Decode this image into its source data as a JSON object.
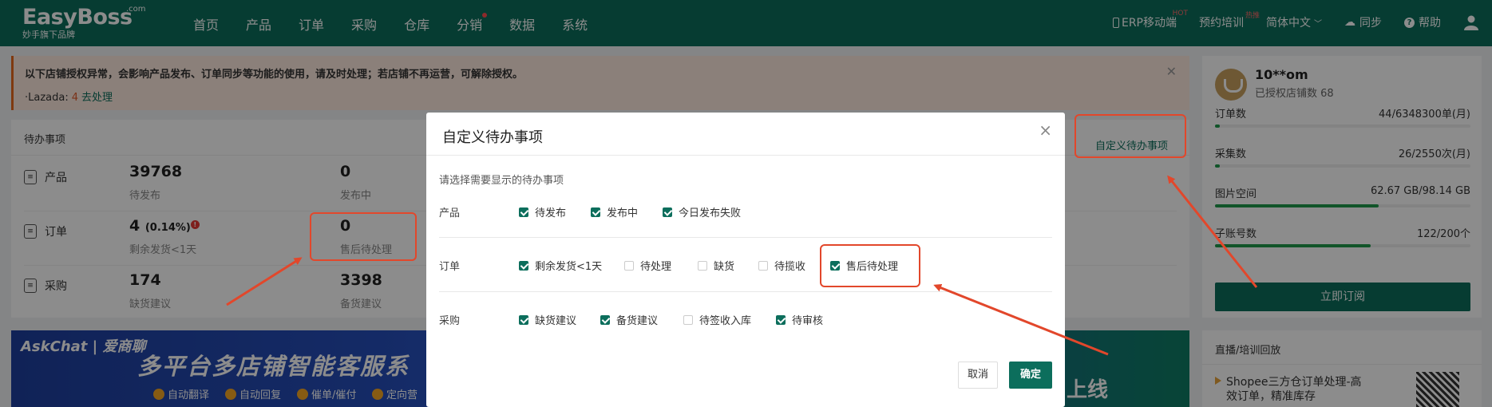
{
  "brand": {
    "name": "EasyBoss",
    "com": ".com",
    "tagline": "妙手旗下品牌"
  },
  "nav": [
    "首页",
    "产品",
    "订单",
    "采购",
    "仓库",
    "分销",
    "数据",
    "系统"
  ],
  "right_nav": {
    "erp": "ERP移动端",
    "erp_badge": "HOT",
    "training": "预约培训",
    "training_badge": "热推",
    "language": "简体中文",
    "sync": "同步",
    "help": "帮助"
  },
  "alert": {
    "message": "以下店铺授权异常，会影响产品发布、订单同步等功能的使用，请及时处理；若店铺不再运营，可解除授权。",
    "platform": "·Lazada:",
    "count": "4",
    "action": "去处理"
  },
  "todo": {
    "title": "待办事项",
    "custom_link": "自定义待办事项",
    "rows": [
      {
        "label": "产品",
        "items": [
          {
            "value": "39768",
            "label": "待发布"
          },
          {
            "value": "0",
            "label": "发布中"
          }
        ]
      },
      {
        "label": "订单",
        "items": [
          {
            "value": "4",
            "pct": "(0.14%)",
            "label": "剩余发货<1天"
          },
          {
            "value": "0",
            "label": "售后待处理"
          }
        ]
      },
      {
        "label": "采购",
        "items": [
          {
            "value": "174",
            "label": "缺货建议"
          },
          {
            "value": "3398",
            "label": "备货建议"
          }
        ]
      }
    ]
  },
  "banner": {
    "logo": "AskChat | 爱商聊",
    "headline": "多平台多店铺智能客服系",
    "features": [
      "自动翻译",
      "自动回复",
      "催单/催付",
      "定向营"
    ],
    "online": "上线"
  },
  "account": {
    "name": "10**om",
    "shops": "已授权店铺数 68",
    "stats": [
      {
        "key": "订单数",
        "value": "44/6348300单(月)",
        "ratio": 0.01
      },
      {
        "key": "采集数",
        "value": "26/2550次(月)",
        "ratio": 0.01
      },
      {
        "key": "图片空间",
        "value": "62.67 GB/98.14 GB",
        "ratio": 0.64
      },
      {
        "key": "子账号数",
        "value": "122/200个",
        "ratio": 0.61
      }
    ],
    "subscribe": "立即订阅"
  },
  "live": {
    "title": "直播/培训回放",
    "line1": "Shopee三方仓订单处理-高",
    "line2": "效订单，精准库存"
  },
  "modal": {
    "title": "自定义待办事项",
    "hint": "请选择需要显示的待办事项",
    "groups": [
      {
        "label": "产品",
        "options": [
          {
            "text": "待发布",
            "checked": true
          },
          {
            "text": "发布中",
            "checked": true
          },
          {
            "text": "今日发布失败",
            "checked": true
          }
        ]
      },
      {
        "label": "订单",
        "options": [
          {
            "text": "剩余发货<1天",
            "checked": true
          },
          {
            "text": "待处理",
            "checked": false
          },
          {
            "text": "缺货",
            "checked": false
          },
          {
            "text": "待揽收",
            "checked": false
          },
          {
            "text": "售后待处理",
            "checked": true
          }
        ]
      },
      {
        "label": "采购",
        "options": [
          {
            "text": "缺货建议",
            "checked": true
          },
          {
            "text": "备货建议",
            "checked": true
          },
          {
            "text": "待签收入库",
            "checked": false
          },
          {
            "text": "待审核",
            "checked": true
          }
        ]
      }
    ],
    "cancel": "取消",
    "ok": "确定"
  },
  "colors": {
    "primary": "#0c6e5c",
    "highlight": "#e2472b"
  }
}
